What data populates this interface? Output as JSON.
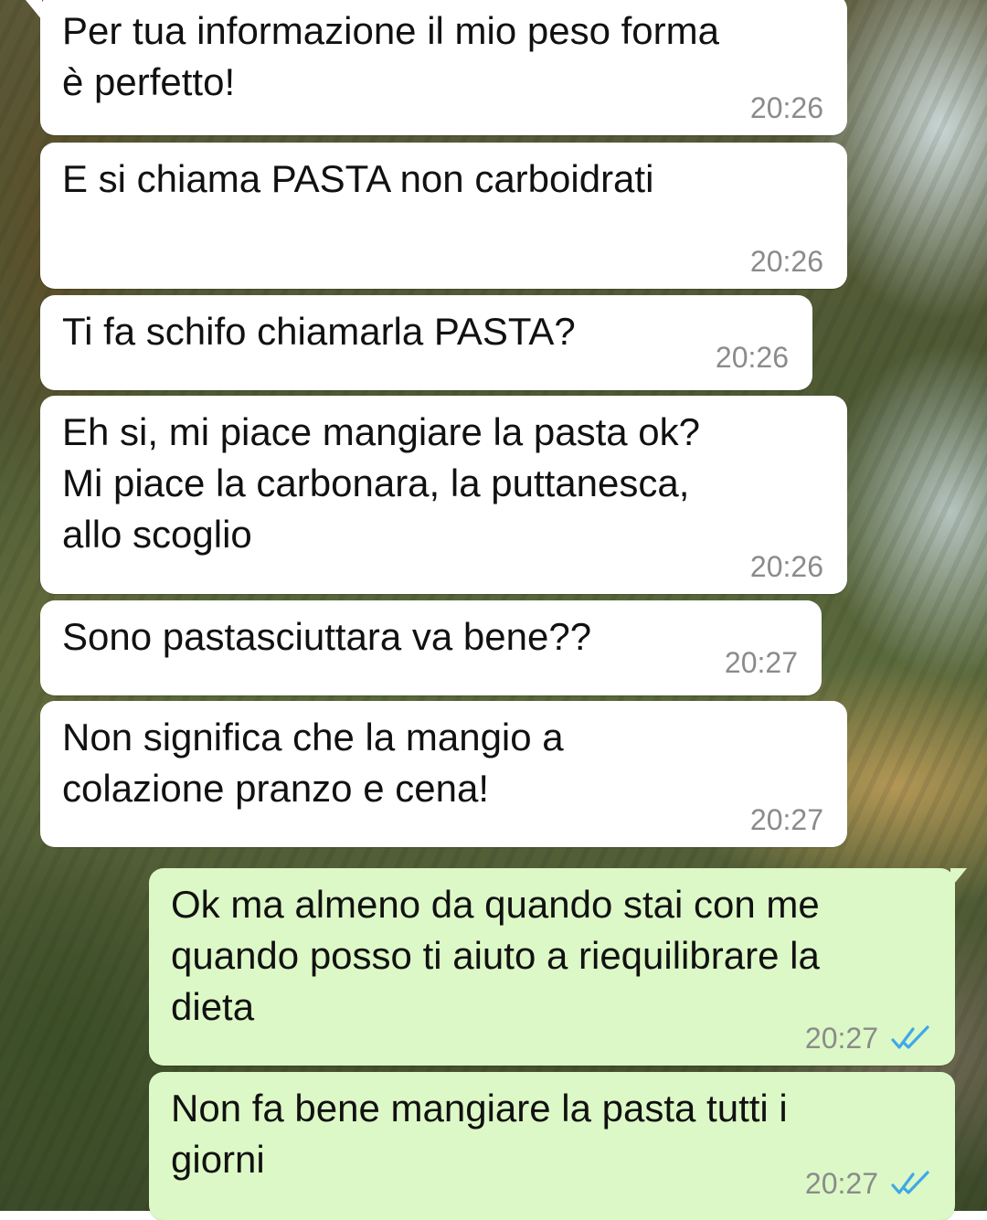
{
  "colors": {
    "incoming_bubble": "#ffffff",
    "outgoing_bubble": "#dcf8c6",
    "timestamp": "#8b8b8b",
    "read_ticks": "#3fa8e8"
  },
  "messages": [
    {
      "direction": "incoming",
      "text": "Per tua informazione il mio peso forma\nè perfetto!",
      "time": "20:26"
    },
    {
      "direction": "incoming",
      "text": "E si chiama PASTA non carboidrati",
      "time": "20:26"
    },
    {
      "direction": "incoming",
      "text": "Ti fa schifo chiamarla PASTA?",
      "time": "20:26"
    },
    {
      "direction": "incoming",
      "text": "Eh si, mi piace mangiare la pasta ok?\nMi piace la carbonara, la puttanesca,\nallo scoglio",
      "time": "20:26"
    },
    {
      "direction": "incoming",
      "text": "Sono pastasciuttara va bene??",
      "time": "20:27"
    },
    {
      "direction": "incoming",
      "text": "Non significa che la mangio a\ncolazione pranzo e cena!",
      "time": "20:27"
    },
    {
      "direction": "outgoing",
      "text": "Ok ma almeno da quando stai con me\nquando posso ti aiuto a riequilibrare la\ndieta",
      "time": "20:27",
      "status_icon": "double-check-read-icon"
    },
    {
      "direction": "outgoing",
      "text": "Non fa bene mangiare la pasta tutti i\ngiorni",
      "time": "20:27",
      "status_icon": "double-check-read-icon"
    }
  ]
}
